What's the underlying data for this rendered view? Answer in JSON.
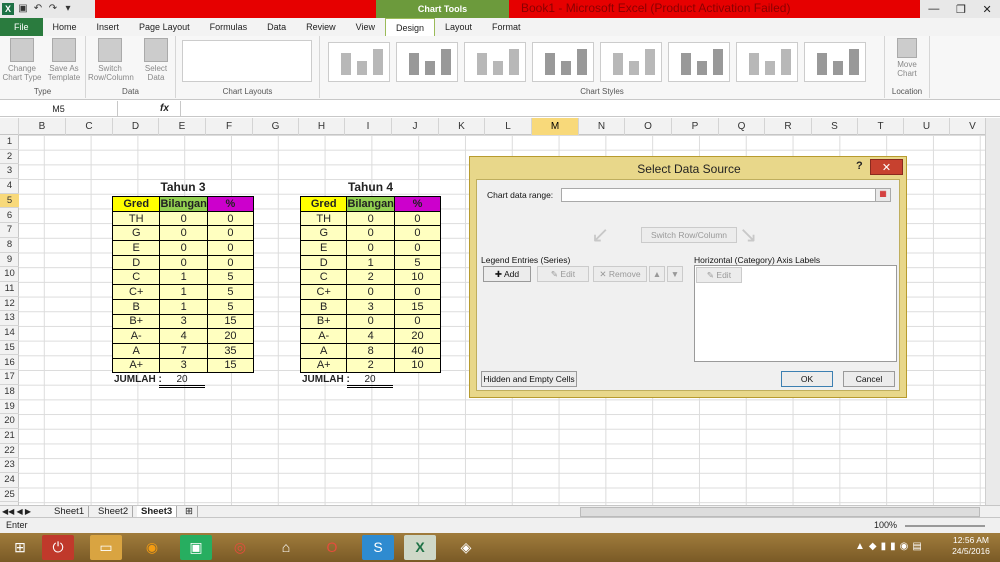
{
  "window": {
    "title": "Book1 - Microsoft Excel (Product Activation Failed)",
    "context_tab": "Chart Tools"
  },
  "ribbon_tabs": [
    "File",
    "Home",
    "Insert",
    "Page Layout",
    "Formulas",
    "Data",
    "Review",
    "View",
    "Design",
    "Layout",
    "Format"
  ],
  "active_tab": "Design",
  "ribbon": {
    "type_group": {
      "label": "Type",
      "button": "Change Chart Type",
      "button2": "Save As Template"
    },
    "data_group": {
      "label": "Data",
      "switch": "Switch Row/Column",
      "select": "Select Data"
    },
    "layouts_group": {
      "label": "Chart Layouts"
    },
    "styles_group": {
      "label": "Chart Styles"
    },
    "location_group": {
      "label": "Location",
      "move": "Move Chart"
    }
  },
  "formula_bar": {
    "name_box": "M5",
    "fx": "fx",
    "content": ""
  },
  "columns": [
    "B",
    "C",
    "D",
    "E",
    "F",
    "G",
    "H",
    "I",
    "J",
    "K",
    "L",
    "M",
    "N",
    "O",
    "P",
    "Q",
    "R",
    "S",
    "T",
    "U",
    "V"
  ],
  "selected_column": "M",
  "rows": [
    "1",
    "2",
    "3",
    "4",
    "5",
    "6",
    "7",
    "8",
    "9",
    "10",
    "11",
    "12",
    "13",
    "14",
    "15",
    "16",
    "17",
    "18",
    "19",
    "20",
    "21",
    "22",
    "23",
    "24",
    "25"
  ],
  "selected_row": "5",
  "table3": {
    "title": "Tahun 3",
    "headers": [
      "Gred",
      "Bilangan",
      "%"
    ],
    "rows": [
      [
        "TH",
        "0",
        "0"
      ],
      [
        "G",
        "0",
        "0"
      ],
      [
        "E",
        "0",
        "0"
      ],
      [
        "D",
        "0",
        "0"
      ],
      [
        "C",
        "1",
        "5"
      ],
      [
        "C+",
        "1",
        "5"
      ],
      [
        "B",
        "1",
        "5"
      ],
      [
        "B+",
        "3",
        "15"
      ],
      [
        "A-",
        "4",
        "20"
      ],
      [
        "A",
        "7",
        "35"
      ],
      [
        "A+",
        "3",
        "15"
      ]
    ],
    "total_label": "JUMLAH :",
    "total": "20"
  },
  "table4": {
    "title": "Tahun 4",
    "headers": [
      "Gred",
      "Bilangan",
      "%"
    ],
    "rows": [
      [
        "TH",
        "0",
        "0"
      ],
      [
        "G",
        "0",
        "0"
      ],
      [
        "E",
        "0",
        "0"
      ],
      [
        "D",
        "1",
        "5"
      ],
      [
        "C",
        "2",
        "10"
      ],
      [
        "C+",
        "0",
        "0"
      ],
      [
        "B",
        "3",
        "15"
      ],
      [
        "B+",
        "0",
        "0"
      ],
      [
        "A-",
        "4",
        "20"
      ],
      [
        "A",
        "8",
        "40"
      ],
      [
        "A+",
        "2",
        "10"
      ]
    ],
    "total_label": "JUMLAH :",
    "total": "20"
  },
  "dialog": {
    "title": "Select Data Source",
    "help": "?",
    "close": "✕",
    "range_label": "Chart data range:",
    "range_value": "",
    "switch": "Switch Row/Column",
    "legend_label": "Legend Entries (Series)",
    "add": "Add",
    "edit": "Edit",
    "remove": "Remove",
    "axis_label": "Horizontal (Category) Axis Labels",
    "axis_edit": "Edit",
    "hidden": "Hidden and Empty Cells",
    "ok": "OK",
    "cancel": "Cancel"
  },
  "sheets": [
    "Sheet1",
    "Sheet2",
    "Sheet3"
  ],
  "active_sheet": "Sheet3",
  "status": {
    "mode": "Enter",
    "zoom": "100%"
  },
  "clock": {
    "time": "12:56 AM",
    "date": "24/5/2016"
  }
}
